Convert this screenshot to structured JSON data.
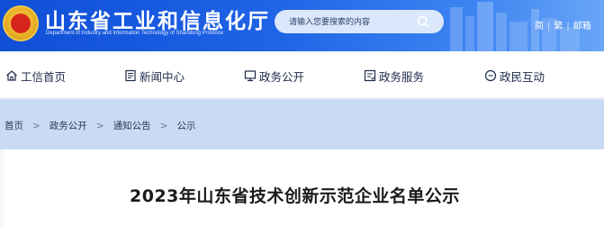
{
  "header": {
    "title": "山东省工业和信息化厅",
    "subtitle": "Department of Industry and Information Technology of Shandong Province",
    "search": {
      "placeholder": "请输入您要搜索的内容",
      "icon": "search-icon"
    },
    "top_links": [
      "简",
      "繁",
      "邮箱"
    ]
  },
  "nav": {
    "items": [
      {
        "label": "工信首页",
        "icon": "home-icon"
      },
      {
        "label": "新闻中心",
        "icon": "news-icon"
      },
      {
        "label": "政务公开",
        "icon": "monitor-icon"
      },
      {
        "label": "政务服务",
        "icon": "service-icon"
      },
      {
        "label": "政民互动",
        "icon": "chat-icon"
      }
    ]
  },
  "breadcrumb": [
    "首页",
    "政务公开",
    "通知公告",
    "公示"
  ],
  "breadcrumb_sep": ">",
  "article": {
    "title": "2023年山东省技术创新示范企业名单公示"
  },
  "colors": {
    "header_blue": "#1f63e6",
    "crumb_bg": "#c9dbf4"
  }
}
